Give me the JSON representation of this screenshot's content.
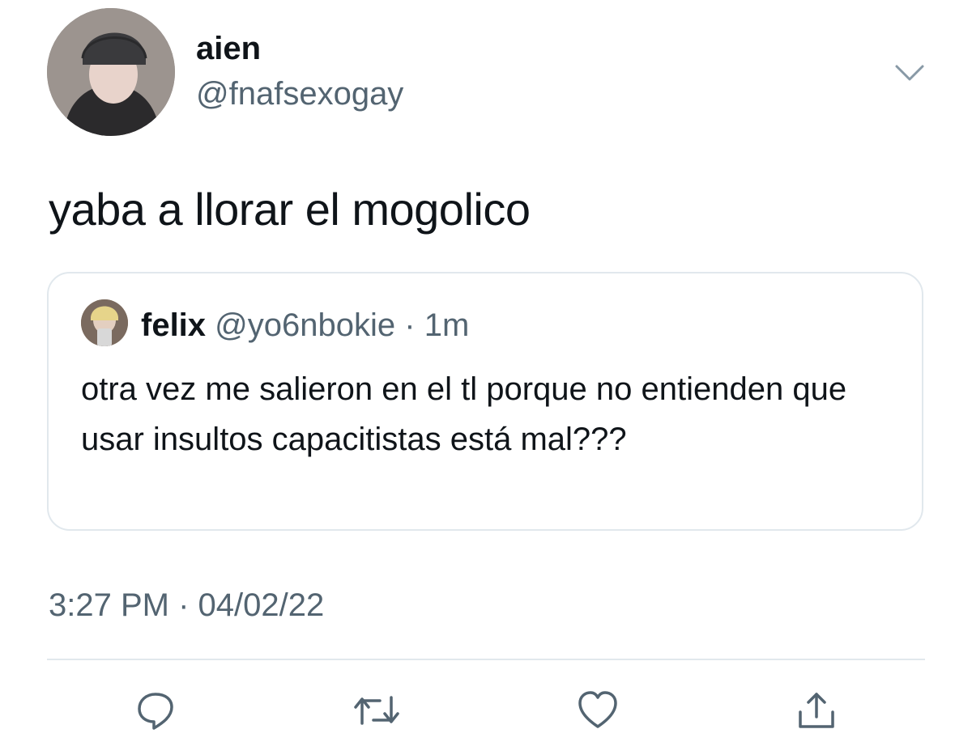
{
  "author": {
    "display_name": "aien",
    "handle": "@fnafsexogay",
    "avatar_icon": "profile-photo"
  },
  "tweet": {
    "text": "yaba a llorar el mogolico",
    "timestamp": "3:27 PM · 04/02/22"
  },
  "quoted_tweet": {
    "display_name": "felix",
    "handle": "@yo6nbokie",
    "separator": "·",
    "time": "1m",
    "text": "otra vez me salieron en el tl porque no entienden que usar insultos capacitistas está mal???"
  },
  "actions": [
    "reply-icon",
    "retweet-icon",
    "like-icon",
    "share-icon"
  ],
  "colors": {
    "text": "#0f1419",
    "secondary": "#536471",
    "border": "#e1e8ed"
  }
}
